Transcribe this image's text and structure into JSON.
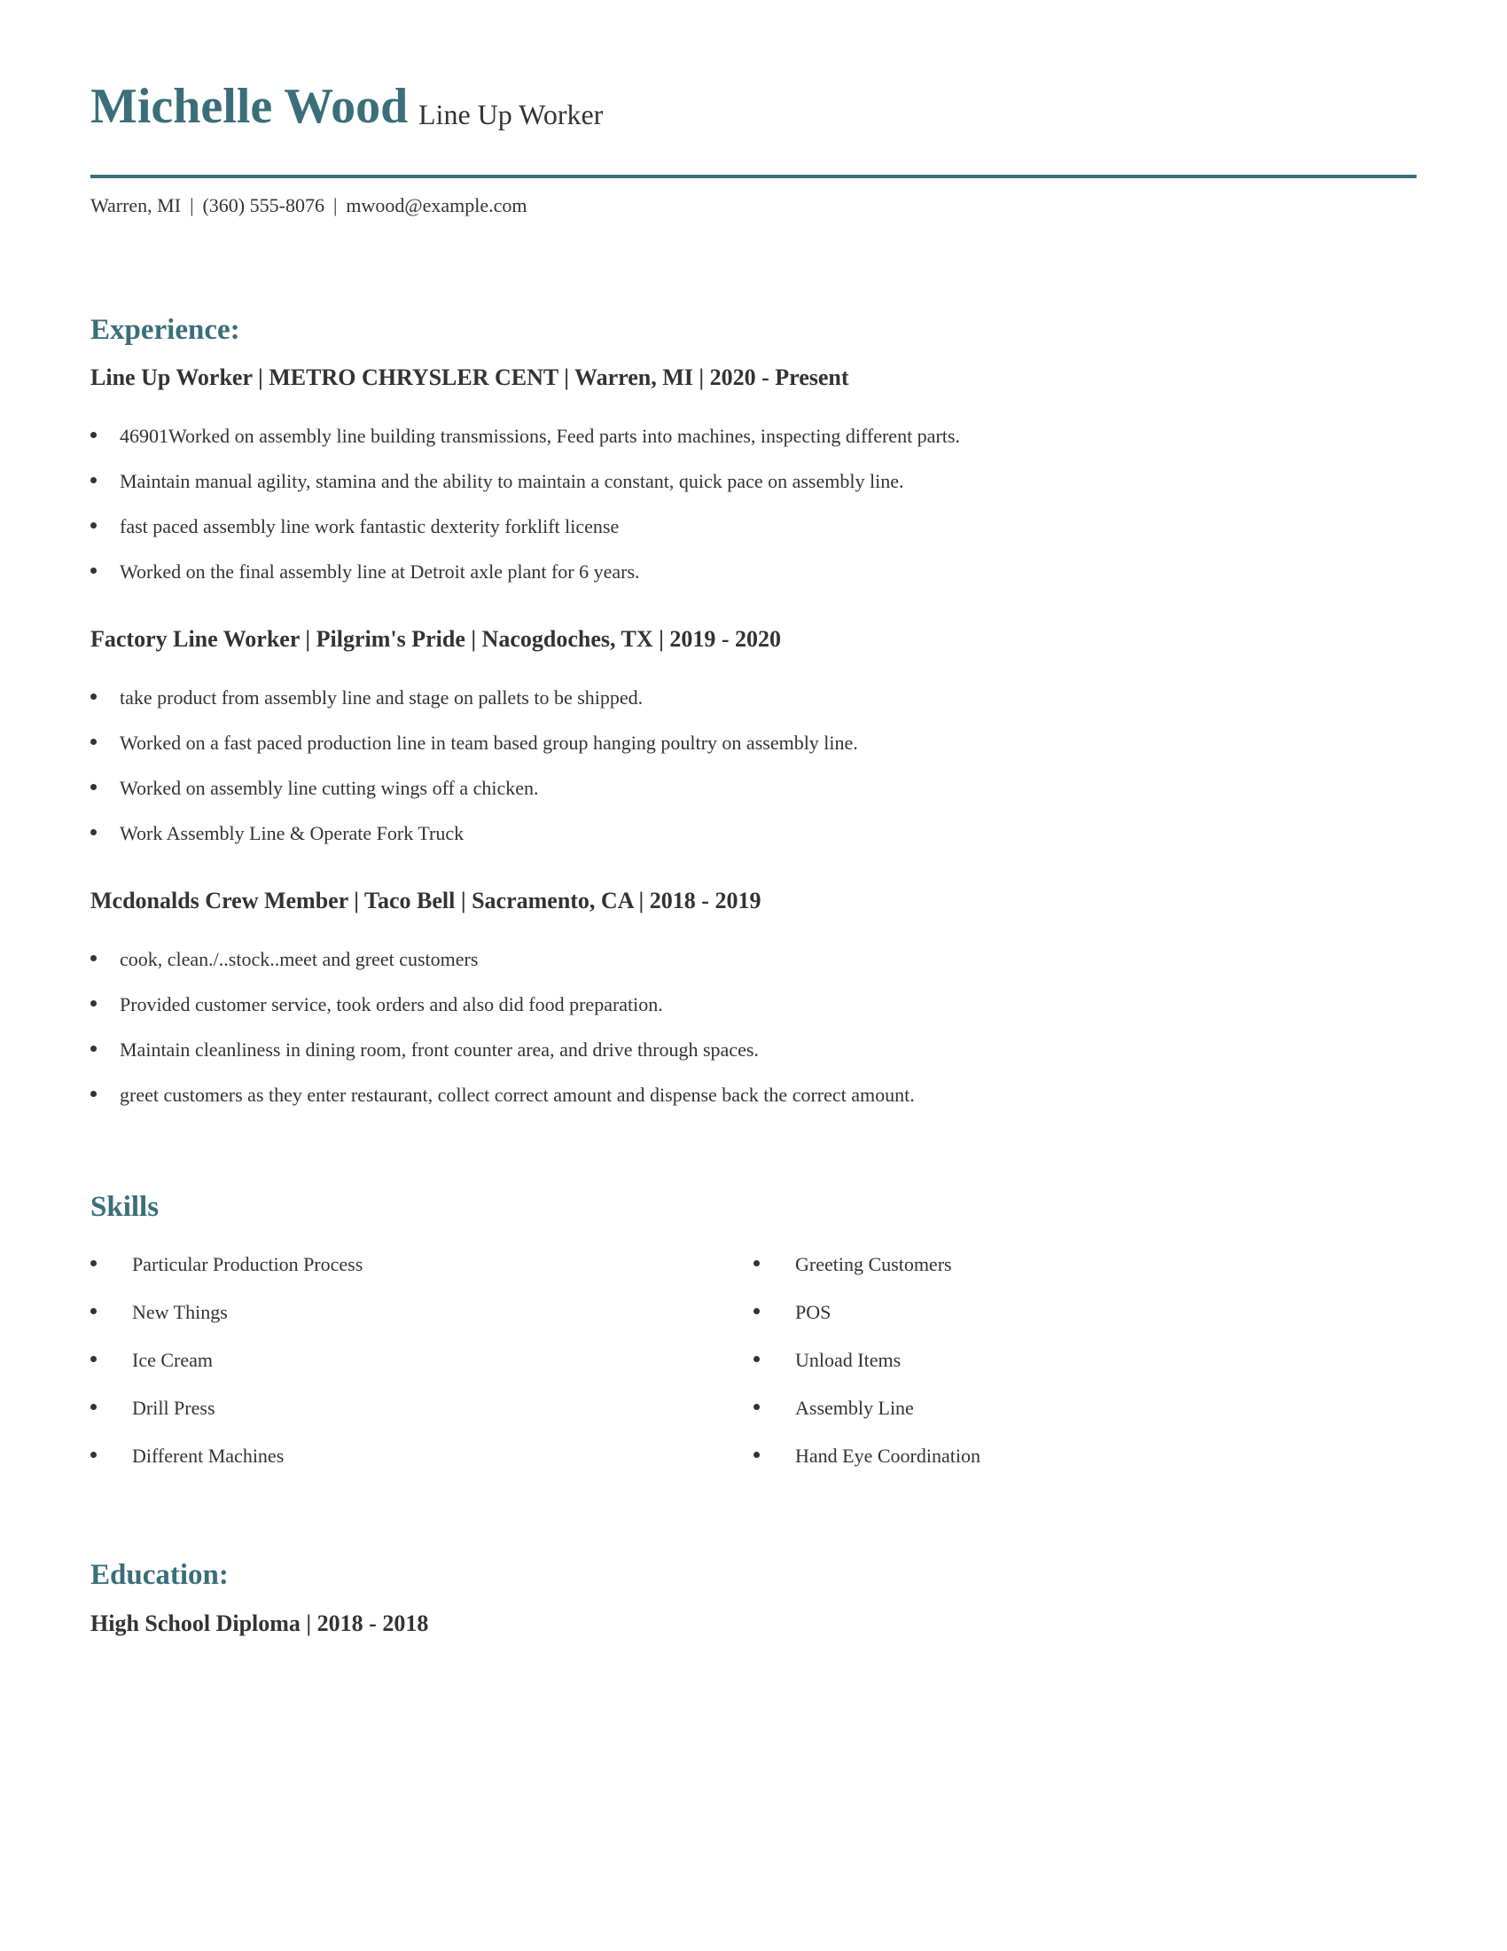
{
  "header": {
    "name": "Michelle Wood",
    "title": "Line Up Worker",
    "contact": {
      "location": "Warren, MI",
      "phone": "(360) 555-8076",
      "email": "mwood@example.com",
      "separator": "|"
    }
  },
  "colors": {
    "accent": "#3a6e7a",
    "text": "#333333"
  },
  "experience": {
    "heading": "Experience:",
    "jobs": [
      {
        "header": "Line Up Worker | METRO CHRYSLER CENT | Warren, MI |  2020 - Present",
        "bullets": [
          "46901Worked on assembly line building transmissions, Feed parts into machines, inspecting different parts.",
          "Maintain manual agility, stamina and the ability to maintain a constant, quick pace on assembly line.",
          "fast paced assembly line work fantastic dexterity forklift license",
          "Worked on the final assembly line at Detroit axle plant for 6 years."
        ]
      },
      {
        "header": "Factory Line Worker | Pilgrim's Pride | Nacogdoches, TX |  2019 - 2020",
        "bullets": [
          "take product from assembly line and stage on pallets to be shipped.",
          "Worked on a fast paced production line in team based group hanging poultry on assembly line.",
          "Worked on assembly line cutting wings off a chicken.",
          "Work Assembly Line & Operate Fork Truck"
        ]
      },
      {
        "header": "Mcdonalds Crew Member | Taco Bell | Sacramento, CA |  2018 - 2019",
        "bullets": [
          "cook, clean./..stock..meet and greet customers",
          "Provided customer service, took orders and also did food preparation.",
          "Maintain cleanliness in dining room, front counter area, and drive through spaces.",
          "greet customers as they enter restaurant, collect correct amount and dispense back the correct amount."
        ]
      }
    ]
  },
  "skills": {
    "heading": "Skills",
    "left": [
      "Particular Production Process",
      "New Things",
      "Ice Cream",
      "Drill Press",
      "Different Machines"
    ],
    "right": [
      "Greeting Customers",
      "POS",
      "Unload Items",
      "Assembly Line",
      "Hand Eye Coordination"
    ]
  },
  "education": {
    "heading": "Education:",
    "entries": [
      "High School Diploma |  2018 - 2018"
    ]
  }
}
